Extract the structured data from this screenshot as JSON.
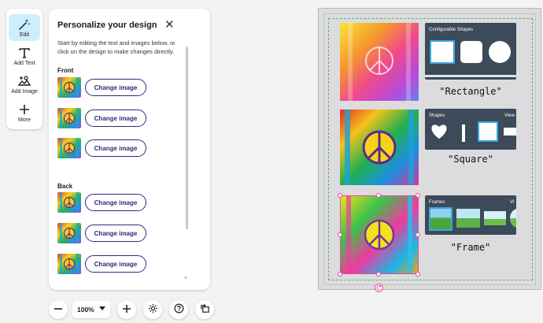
{
  "toolbar": {
    "items": [
      {
        "label": "Edit",
        "icon": "magic-wand-icon",
        "active": true
      },
      {
        "label": "Add Text",
        "icon": "text-t-icon"
      },
      {
        "label": "Add Image",
        "icon": "image-add-icon"
      },
      {
        "label": "More",
        "icon": "plus-icon"
      }
    ]
  },
  "panel": {
    "title": "Personalize your design",
    "close_icon": "close-icon",
    "description": "Start by editing the text and images below, or click on the design to make changes directly.",
    "front_label": "Front",
    "back_label": "Back",
    "change_label": "Change image"
  },
  "bottom_bar": {
    "zoom": "100%",
    "zoom_out_icon": "minus-icon",
    "zoom_in_icon": "plus-icon",
    "settings_icon": "gear-icon",
    "help_icon": "help-icon",
    "rotate_icon": "rotate-view-icon"
  },
  "canvas": {
    "card1": {
      "title": "Configurable Shapes",
      "caption": "\"Rectangle\""
    },
    "card2": {
      "title": "Shapes",
      "more": "View",
      "caption": "\"Square\""
    },
    "card3": {
      "title": "Frames",
      "more": "Vi",
      "caption": "\"Frame\""
    }
  },
  "colors": {
    "accent": "#2c2c7a",
    "active_tool": "#cdeffb",
    "selection": "#e24a9a",
    "safe_zone": "#56b56b",
    "card_bg": "#3c4a59"
  }
}
